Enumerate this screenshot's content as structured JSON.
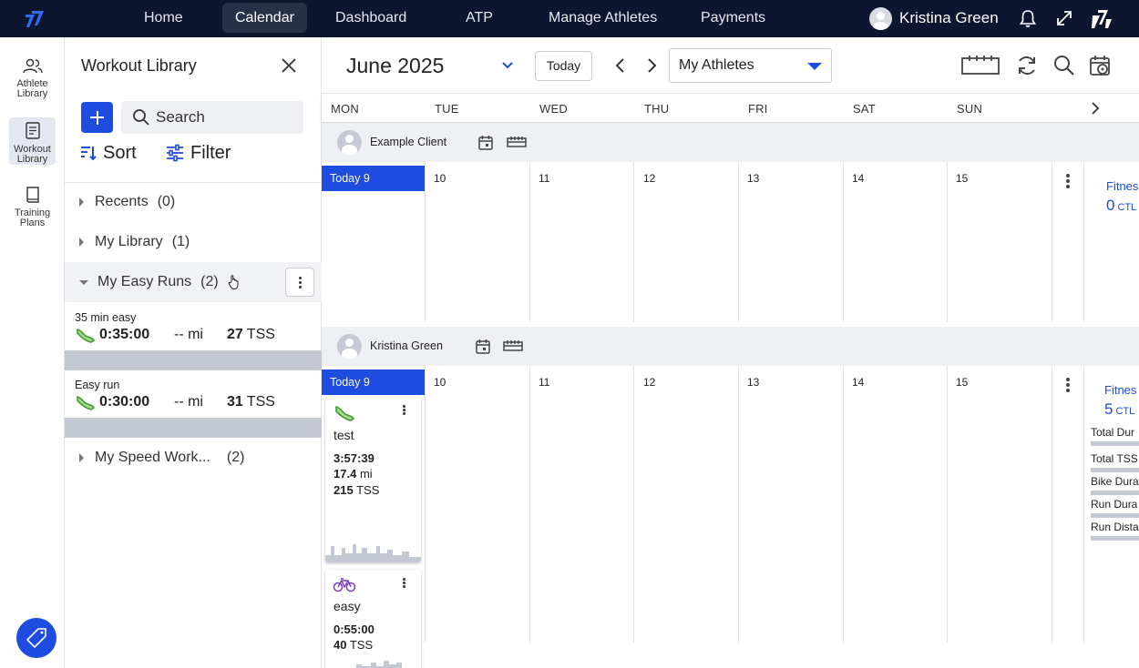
{
  "topnav": {
    "items": [
      "Home",
      "Calendar",
      "Dashboard",
      "ATP",
      "Manage Athletes",
      "Payments"
    ],
    "active": "Calendar",
    "user_name": "Kristina Green"
  },
  "rail": {
    "items": [
      {
        "label": "Athlete Library",
        "icon": "athletes-icon"
      },
      {
        "label": "Workout Library",
        "icon": "library-icon"
      },
      {
        "label": "Training Plans",
        "icon": "book-icon"
      }
    ]
  },
  "library": {
    "title": "Workout Library",
    "search_placeholder": "Search",
    "sort_label": "Sort",
    "filter_label": "Filter",
    "folders": [
      {
        "name": "Recents",
        "count": "(0)"
      },
      {
        "name": "My Library",
        "count": "(1)"
      },
      {
        "name": "My Easy Runs",
        "count": "(2)"
      },
      {
        "name": "My Speed Work...",
        "count": "(2)"
      }
    ],
    "workouts": [
      {
        "name": "35 min easy",
        "duration": "0:35:00",
        "distance": "-- mi",
        "tss_value": "27",
        "tss_unit": "TSS"
      },
      {
        "name": "Easy run",
        "duration": "0:30:00",
        "distance": "-- mi",
        "tss_value": "31",
        "tss_unit": "TSS"
      }
    ]
  },
  "calendar": {
    "month": "June 2025",
    "today_label": "Today",
    "athlete_filter": "My Athletes",
    "days": [
      "MON",
      "TUE",
      "WED",
      "THU",
      "FRI",
      "SAT",
      "SUN"
    ],
    "dates": [
      "Today 9",
      "10",
      "11",
      "12",
      "13",
      "14",
      "15"
    ],
    "athletes": [
      {
        "name": "Example Client",
        "fitness_label": "Fitnes",
        "ctl_value": "0",
        "ctl_unit": "CTL"
      },
      {
        "name": "Kristina Green",
        "fitness_label": "Fitnes",
        "ctl_value": "5",
        "ctl_unit": "CTL",
        "summary": [
          "Total Dur",
          "Total TSS",
          "Bike Dura",
          "Run Dura",
          "Run Dista"
        ]
      }
    ],
    "cards": [
      {
        "title": "test",
        "sport": "run",
        "duration": "3:57:39",
        "distance_value": "17.4",
        "distance_unit": "mi",
        "tss_value": "215",
        "tss_unit": "TSS"
      },
      {
        "title": "easy",
        "sport": "bike",
        "duration": "0:55:00",
        "tss_value": "40",
        "tss_unit": "TSS"
      }
    ]
  },
  "colors": {
    "nav_bg": "#0d1630",
    "accent": "#1e4be0",
    "run_green": "#3f9e2e",
    "bike_purple": "#7a3fb5"
  }
}
